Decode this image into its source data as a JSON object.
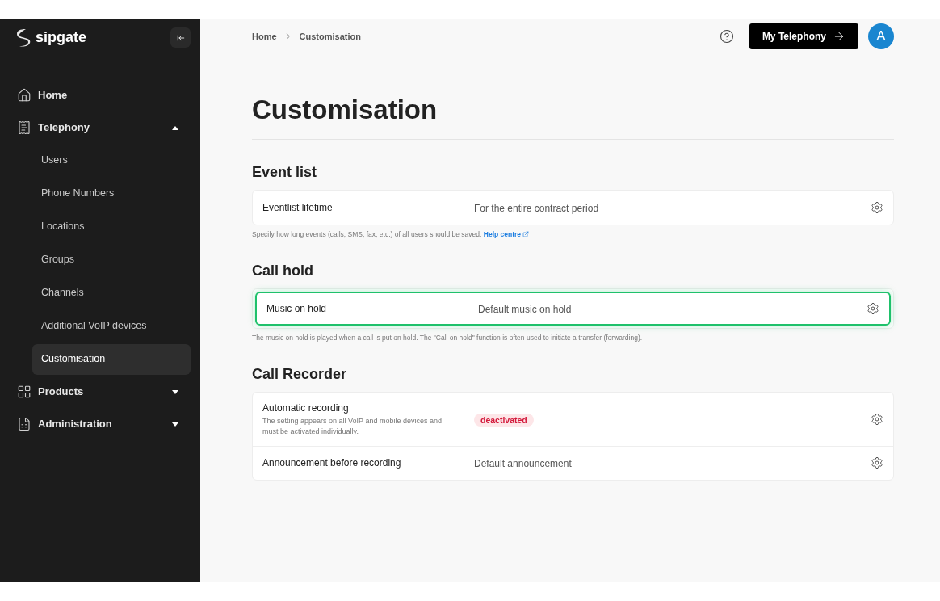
{
  "sidebar": {
    "logo": "sipgate",
    "items": [
      {
        "kind": "home",
        "label": "Home"
      },
      {
        "kind": "telephony",
        "label": "Telephony",
        "expanded": true,
        "children": [
          {
            "label": "Users",
            "selected": false
          },
          {
            "label": "Phone Numbers",
            "selected": false
          },
          {
            "label": "Locations",
            "selected": false
          },
          {
            "label": "Groups",
            "selected": false
          },
          {
            "label": "Channels",
            "selected": false
          },
          {
            "label": "Additional VoIP devices",
            "selected": false
          },
          {
            "label": "Customisation",
            "selected": true
          }
        ]
      },
      {
        "kind": "products",
        "label": "Products",
        "expanded": false
      },
      {
        "kind": "administration",
        "label": "Administration",
        "expanded": false
      }
    ]
  },
  "header": {
    "breadcrumb": [
      "Home",
      "Customisation"
    ],
    "button": "My Telephony",
    "avatar": "A"
  },
  "title": "Customisation",
  "sections": [
    {
      "heading": "Event list",
      "rows": [
        {
          "label": "Eventlist lifetime",
          "kind": "text",
          "value": "For the entire contract period",
          "focused": false
        }
      ],
      "note": "Specify how long events (calls, SMS, fax, etc.) of all users should be saved.",
      "link": "Help centre"
    },
    {
      "heading": "Call hold",
      "rows": [
        {
          "label": "Music on hold",
          "kind": "text",
          "value": "Default music on hold",
          "focused": true
        }
      ],
      "note": "The music on hold is played when a call is put on hold. The \"Call on hold\" function is often used to initiate a transfer (forwarding)."
    },
    {
      "heading": "Call Recorder",
      "rows": [
        {
          "label": "Automatic recording",
          "description": "The setting appears on all VoIP and mobile devices and must be activated individually.",
          "kind": "badge",
          "value": "deactivated",
          "focused": false
        },
        {
          "label": "Announcement before recording",
          "kind": "text",
          "value": "Default announcement",
          "focused": false
        }
      ]
    }
  ]
}
